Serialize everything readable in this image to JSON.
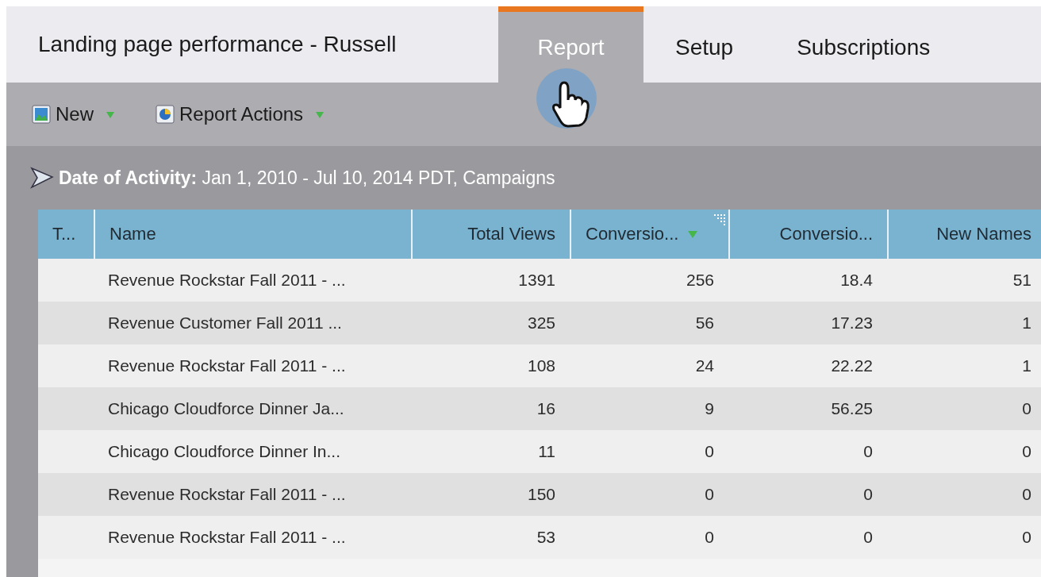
{
  "report_title": "Landing page performance - Russell",
  "tabs": [
    {
      "label": "Report",
      "selected": true
    },
    {
      "label": "Setup",
      "selected": false
    },
    {
      "label": "Subscriptions",
      "selected": false
    }
  ],
  "toolbar": [
    {
      "label": "New",
      "kind": "new"
    },
    {
      "label": "Report Actions",
      "kind": "actions"
    }
  ],
  "filter": "**Date of Activity:** Jan 1, 2010 - Jul 10, 2014 PDT, Campaigns",
  "table": {
    "columns": [
      {
        "label": "T...",
        "sorted": false
      },
      {
        "label": "Name",
        "sorted": false
      },
      {
        "label": "Total Views",
        "sorted": false
      },
      {
        "label": "Conversio...",
        "sorted": true
      },
      {
        "label": "Conversio...",
        "sorted": false
      },
      {
        "label": "New Names",
        "sorted": false
      }
    ],
    "rows": [
      [
        "",
        "Revenue Rockstar Fall 2011 - ...",
        "1391",
        "256",
        "18.4",
        "51"
      ],
      [
        "",
        "Revenue Customer Fall 2011 ...",
        "325",
        "56",
        "17.23",
        "1"
      ],
      [
        "",
        "Revenue Rockstar Fall 2011 - ...",
        "108",
        "24",
        "22.22",
        "1"
      ],
      [
        "",
        "Chicago Cloudforce Dinner Ja...",
        "16",
        "9",
        "56.25",
        "0"
      ],
      [
        "",
        "Chicago Cloudforce Dinner In...",
        "11",
        "0",
        "0",
        "0"
      ],
      [
        "",
        "Revenue Rockstar Fall 2011 - ...",
        "150",
        "0",
        "0",
        "0"
      ],
      [
        "",
        "Revenue Rockstar Fall 2011 - ...",
        "53",
        "0",
        "0",
        "0"
      ]
    ]
  }
}
